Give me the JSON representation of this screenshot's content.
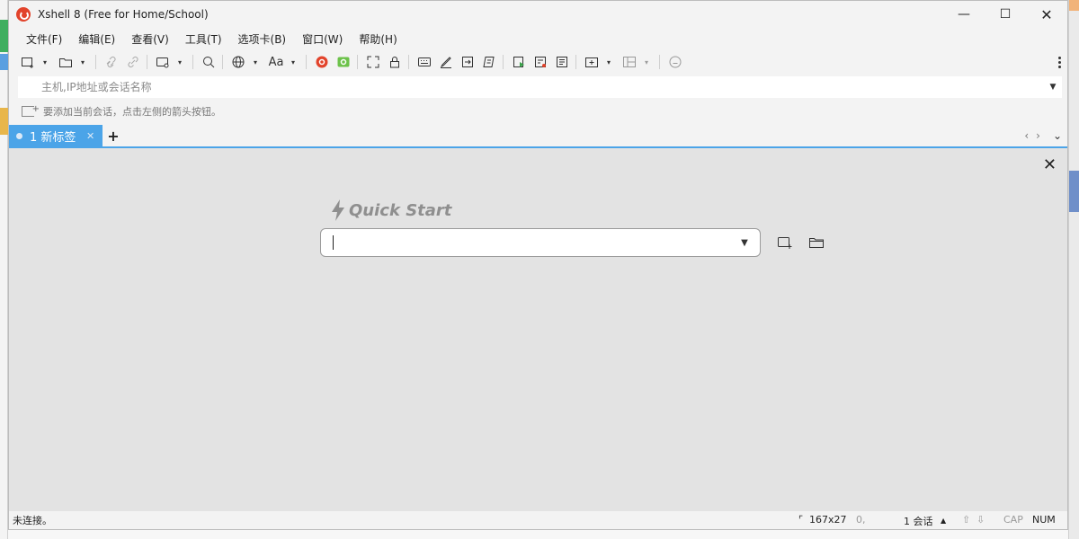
{
  "window": {
    "title": "Xshell 8 (Free for Home/School)",
    "minimize_glyph": "—",
    "maximize_glyph": "☐",
    "close_glyph": "✕"
  },
  "menu": {
    "items": [
      "文件(F)",
      "编辑(E)",
      "查看(V)",
      "工具(T)",
      "选项卡(B)",
      "窗口(W)",
      "帮助(H)"
    ]
  },
  "toolbar": {
    "icons": [
      "new-session-icon",
      "open-folder-icon",
      "disconnect-icon",
      "reconnect-icon",
      "screen-icon",
      "search-icon",
      "globe-icon",
      "font-icon",
      "xshell-icon",
      "xftp-icon",
      "fullscreen-icon",
      "lock-icon",
      "keyboard-icon",
      "script-icon",
      "transfer-icon",
      "note-icon",
      "run-icon",
      "compose-icon",
      "log-icon",
      "add-tab-icon",
      "layout-icon",
      "chat-icon"
    ],
    "font_label": "Aa"
  },
  "address": {
    "placeholder": "主机,IP地址或会话名称"
  },
  "hint": {
    "text": "要添加当前会话，点击左侧的箭头按钮。"
  },
  "tabs": {
    "active_label": "1 新标签",
    "close_glyph": "✕",
    "add_glyph": "+",
    "prev_glyph": "‹",
    "next_glyph": "›",
    "menu_glyph": "⌄"
  },
  "quick_start": {
    "title": "Quick Start",
    "value": "",
    "close_glyph": "✕"
  },
  "status": {
    "connection": "未连接。",
    "size": "167x27",
    "pos": "0,",
    "sessions": "1 会话",
    "cap": "CAP",
    "num": "NUM"
  },
  "colors": {
    "accent": "#4ba4e8",
    "content_bg": "#e3e3e3",
    "chrome_bg": "#f3f3f3"
  }
}
